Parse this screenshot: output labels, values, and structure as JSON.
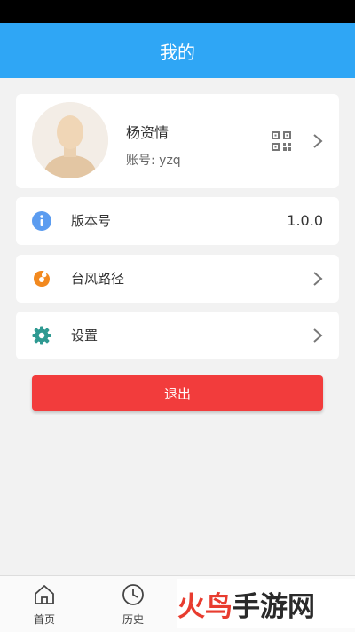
{
  "header": {
    "title": "我的"
  },
  "profile": {
    "name": "杨资情",
    "account_label": "账号:",
    "account_value": "yzq"
  },
  "rows": [
    {
      "label": "版本号",
      "value": "1.0.0",
      "icon": "info-icon"
    },
    {
      "label": "台风路径",
      "icon": "typhoon-icon"
    },
    {
      "label": "设置",
      "icon": "gear-icon"
    }
  ],
  "logout_label": "退出",
  "tabs": [
    {
      "label": "首页",
      "icon": "home-icon"
    },
    {
      "label": "历史",
      "icon": "clock-icon"
    }
  ],
  "watermark": {
    "part1": "火鸟",
    "part2": "手游网"
  },
  "colors": {
    "header": "#2fa6f5",
    "logout": "#f23c3c",
    "info_icon": "#5b9cf0",
    "typhoon_icon": "#f2891f",
    "gear_icon": "#2f9a92"
  }
}
